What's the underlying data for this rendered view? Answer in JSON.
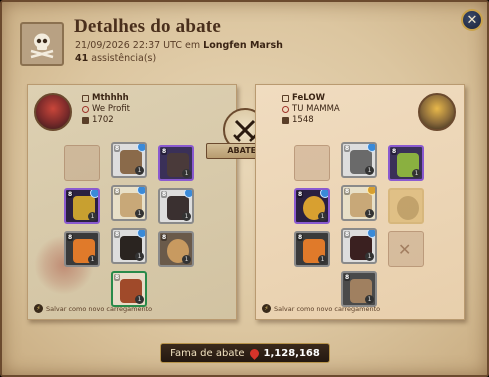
{
  "header": {
    "title": "Detalhes do abate",
    "datetime": "21/09/2026 22:37 UTC em",
    "location": "Longfen Marsh",
    "assist_count": "41",
    "assist_label": "assistência(s)"
  },
  "kill_label": "ABATEU",
  "killer": {
    "name": "Mthhhh",
    "guild": "We Profit",
    "item_power": "1702",
    "reload_label": "Salvar como novo carregamento"
  },
  "victim": {
    "name": "FeLOW",
    "guild": "TU MAMMA",
    "item_power": "1548",
    "reload_label": "Salvar como novo carregamento"
  },
  "fame": {
    "label": "Fama de abate",
    "value": "1,128,168"
  },
  "icons": {
    "badge": "skull-crossbones-icon",
    "close": "close-icon",
    "emblem": "crossed-swords-icon"
  },
  "colors": {
    "accent": "#c9a24a",
    "blood": "#d8342a"
  }
}
